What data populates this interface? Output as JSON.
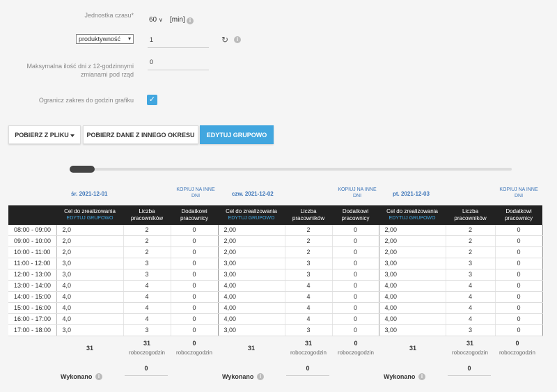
{
  "form": {
    "time_unit_label": "Jednostka czasu*",
    "time_unit_value": "60",
    "time_unit_suffix": "[min]",
    "metric_select": "produktywność",
    "metric_value": "1",
    "max_days_label_1": "Maksymalna ilość dni z 12-godzinnymi",
    "max_days_label_2": "zmianami pod rząd",
    "max_days_value": "0",
    "limit_label": "Ogranicz zakres do godzin grafiku"
  },
  "buttons": {
    "import": "POBIERZ Z PLIKU",
    "other_period": "POBIERZ DANE Z INNEGO OKRESU",
    "bulk_edit": "EDYTUJ GRUPOWO"
  },
  "copy_label_1": "KOPIUJ NA INNE",
  "copy_label_2": "DNI",
  "columns": {
    "goal_1": "Cel do zrealizowania",
    "goal_sub": "EDYTUJ GRUPOWO",
    "workers_1": "Liczba",
    "workers_2": "pracowników",
    "extra_1": "Dodatkowi",
    "extra_2": "pracownicy"
  },
  "days": [
    {
      "title": "śr. 2021-12-01",
      "goal": [
        "2,0",
        "2,0",
        "2,0",
        "3,0",
        "3,0",
        "4,0",
        "4,0",
        "4,0",
        "4,0",
        "3,0"
      ],
      "workers": [
        "2",
        "2",
        "2",
        "3",
        "3",
        "4",
        "4",
        "4",
        "4",
        "3"
      ],
      "extra": [
        "0",
        "0",
        "0",
        "0",
        "0",
        "0",
        "0",
        "0",
        "0",
        "0"
      ],
      "sum_goal": "31",
      "sum_workers": "31",
      "sum_extra": "0",
      "unit": "roboczogodzin",
      "done_label": "Wykonano",
      "done_value": "0"
    },
    {
      "title": "czw. 2021-12-02",
      "goal": [
        "2,00",
        "2,00",
        "2,00",
        "3,00",
        "3,00",
        "4,00",
        "4,00",
        "4,00",
        "4,00",
        "3,00"
      ],
      "workers": [
        "2",
        "2",
        "2",
        "3",
        "3",
        "4",
        "4",
        "4",
        "4",
        "3"
      ],
      "extra": [
        "0",
        "0",
        "0",
        "0",
        "0",
        "0",
        "0",
        "0",
        "0",
        "0"
      ],
      "sum_goal": "31",
      "sum_workers": "31",
      "sum_extra": "0",
      "unit": "roboczogodzin",
      "done_label": "Wykonano",
      "done_value": "0"
    },
    {
      "title": "pt. 2021-12-03",
      "goal": [
        "2,00",
        "2,00",
        "2,00",
        "3,00",
        "3,00",
        "4,00",
        "4,00",
        "4,00",
        "4,00",
        "3,00"
      ],
      "workers": [
        "2",
        "2",
        "2",
        "3",
        "3",
        "4",
        "4",
        "4",
        "4",
        "3"
      ],
      "extra": [
        "0",
        "0",
        "0",
        "0",
        "0",
        "0",
        "0",
        "0",
        "0",
        "0"
      ],
      "sum_goal": "31",
      "sum_workers": "31",
      "sum_extra": "0",
      "unit": "roboczogodzin",
      "done_label": "Wykonano",
      "done_value": "0"
    }
  ],
  "times": [
    "08:00 - 09:00",
    "09:00 - 10:00",
    "10:00 - 11:00",
    "11:00 - 12:00",
    "12:00 - 13:00",
    "13:00 - 14:00",
    "14:00 - 15:00",
    "15:00 - 16:00",
    "16:00 - 17:00",
    "17:00 - 18:00"
  ],
  "colors": {
    "accent": "#41a6df",
    "header_bg": "#222222",
    "link": "#3b74b8"
  }
}
